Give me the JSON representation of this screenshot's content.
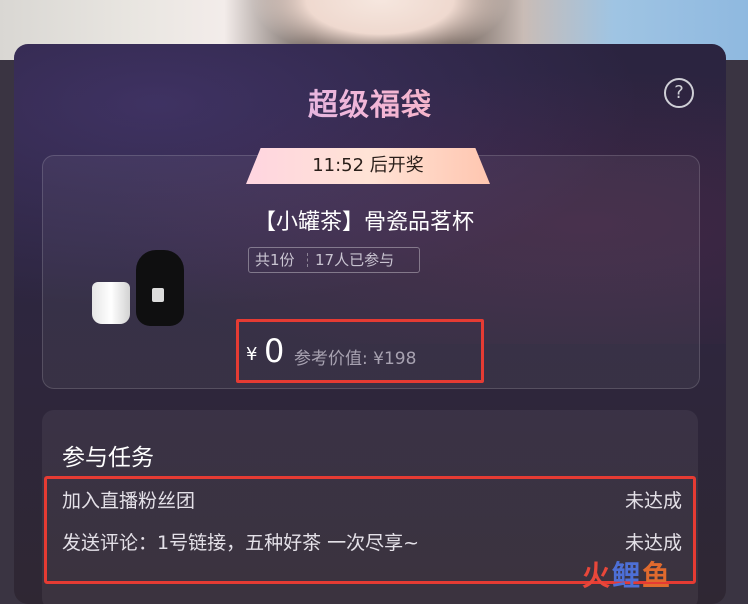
{
  "header": {
    "title": "超级福袋"
  },
  "countdown": {
    "text": "11:52 后开奖"
  },
  "prize": {
    "name": "【小罐茶】骨瓷品茗杯",
    "quantity": "共1份",
    "participants": "17人已参与",
    "currency": "¥",
    "price": "0",
    "reference_price": "参考价值: ¥198"
  },
  "tasks": {
    "title": "参与任务",
    "items": [
      {
        "label": "加入直播粉丝团",
        "status": "未达成"
      },
      {
        "label": "发送评论：1号链接，五种好茶 一次尽享~",
        "status": "未达成"
      }
    ]
  },
  "watermark": {
    "part1": "火",
    "part2": "鲤",
    "part3": "鱼"
  },
  "colors": {
    "highlight_border": "#e53b33",
    "panel_bg": "#2b2440"
  },
  "icons": {
    "help": "question-circle-icon"
  }
}
